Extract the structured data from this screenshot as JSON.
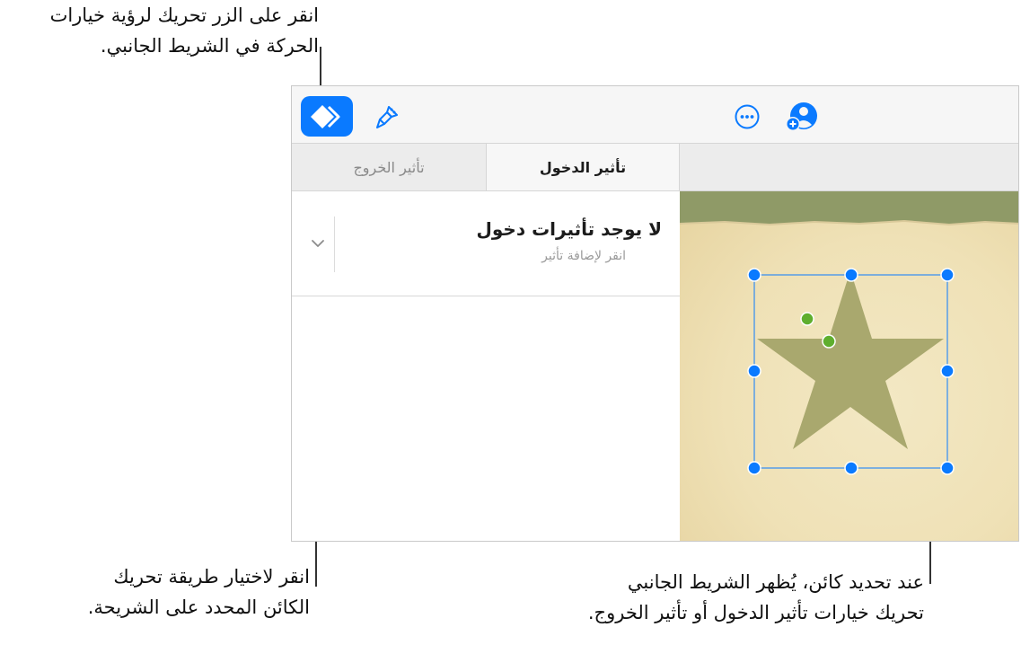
{
  "callouts": {
    "top": [
      "انقر على الزر تحريك لرؤية خيارات",
      "الحركة في الشريط الجانبي."
    ],
    "bottom_left": [
      "انقر لاختيار طريقة تحريك",
      "الكائن المحدد على الشريحة."
    ],
    "bottom_right": [
      "عند تحديد كائن، يُظهر الشريط الجانبي",
      "تحريك خيارات تأثير الدخول أو تأثير الخروج."
    ]
  },
  "toolbar": {
    "animate_icon": "animate-diamond-icon",
    "format_icon": "paintbrush-icon",
    "more_icon": "ellipsis-circle-icon",
    "collaborate_icon": "add-person-icon",
    "accent": "#0a7aff"
  },
  "tabs": {
    "entry": "تأثير الدخول",
    "exit": "تأثير الخروج",
    "selected": "entry"
  },
  "effect": {
    "title": "لا يوجد تأثيرات دخول",
    "subtitle": "انقر لإضافة تأثير",
    "chevron_icon": "chevron-down-icon"
  },
  "slide": {
    "shape": "star",
    "shape_color": "#a9a86e",
    "handle_color": "#0a7aff",
    "rotation_handle_color": "#5fae2e"
  }
}
